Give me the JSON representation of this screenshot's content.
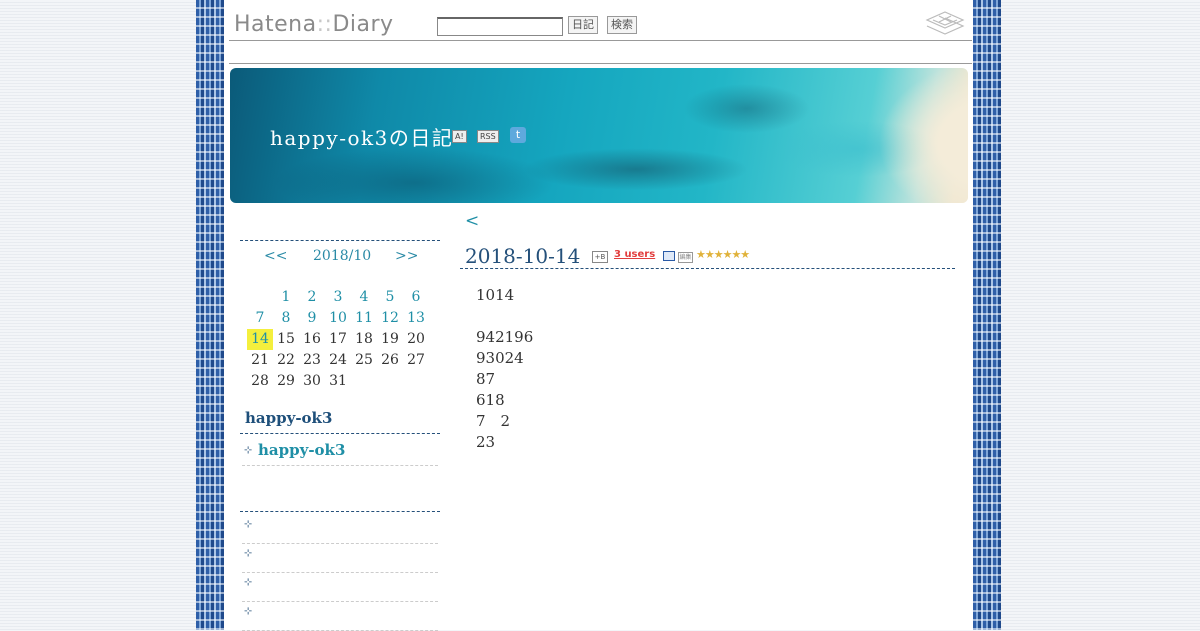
{
  "header": {
    "logo_main": "Hatena",
    "logo_sep": "::",
    "logo_sub": "Diary",
    "search_placeholder": "",
    "diary_button": "日記",
    "search_button": "検索"
  },
  "banner": {
    "title": "happy-ok3の日記",
    "icon_a": "A!",
    "icon_rss": "RSS",
    "twitter_glyph": "t"
  },
  "calendar": {
    "prev": "<<",
    "month": "2018/10",
    "next": ">>",
    "rows": [
      [
        "",
        "1",
        "2",
        "3",
        "4",
        "5",
        "6"
      ],
      [
        "7",
        "8",
        "9",
        "10",
        "11",
        "12",
        "13"
      ],
      [
        "14",
        "15",
        "16",
        "17",
        "18",
        "19",
        "20"
      ],
      [
        "21",
        "22",
        "23",
        "24",
        "25",
        "26",
        "27"
      ],
      [
        "28",
        "29",
        "30",
        "31",
        "",
        "",
        ""
      ]
    ],
    "linked_days": [
      "1",
      "2",
      "3",
      "4",
      "5",
      "6",
      "7",
      "8",
      "9",
      "10",
      "11",
      "12",
      "13",
      "14"
    ],
    "today": "14"
  },
  "sidebar": {
    "title": "happy-ok3",
    "link": "happy-ok3",
    "items": [
      "",
      "",
      "",
      ""
    ]
  },
  "main": {
    "prev_link": "<",
    "date": "2018-10-14",
    "hb_icon": "+B",
    "users_badge": "3 users",
    "edit_icon": "編集",
    "stars": "★★★★★★",
    "lines": [
      "1014",
      "",
      "942196",
      "93024",
      "87",
      "618",
      "7　2",
      "23"
    ]
  },
  "colors": {
    "link": "#1f8fa6",
    "heading": "#24507a",
    "today_highlight": "#f4ef3d",
    "border_blue": "#2f5fa8"
  }
}
